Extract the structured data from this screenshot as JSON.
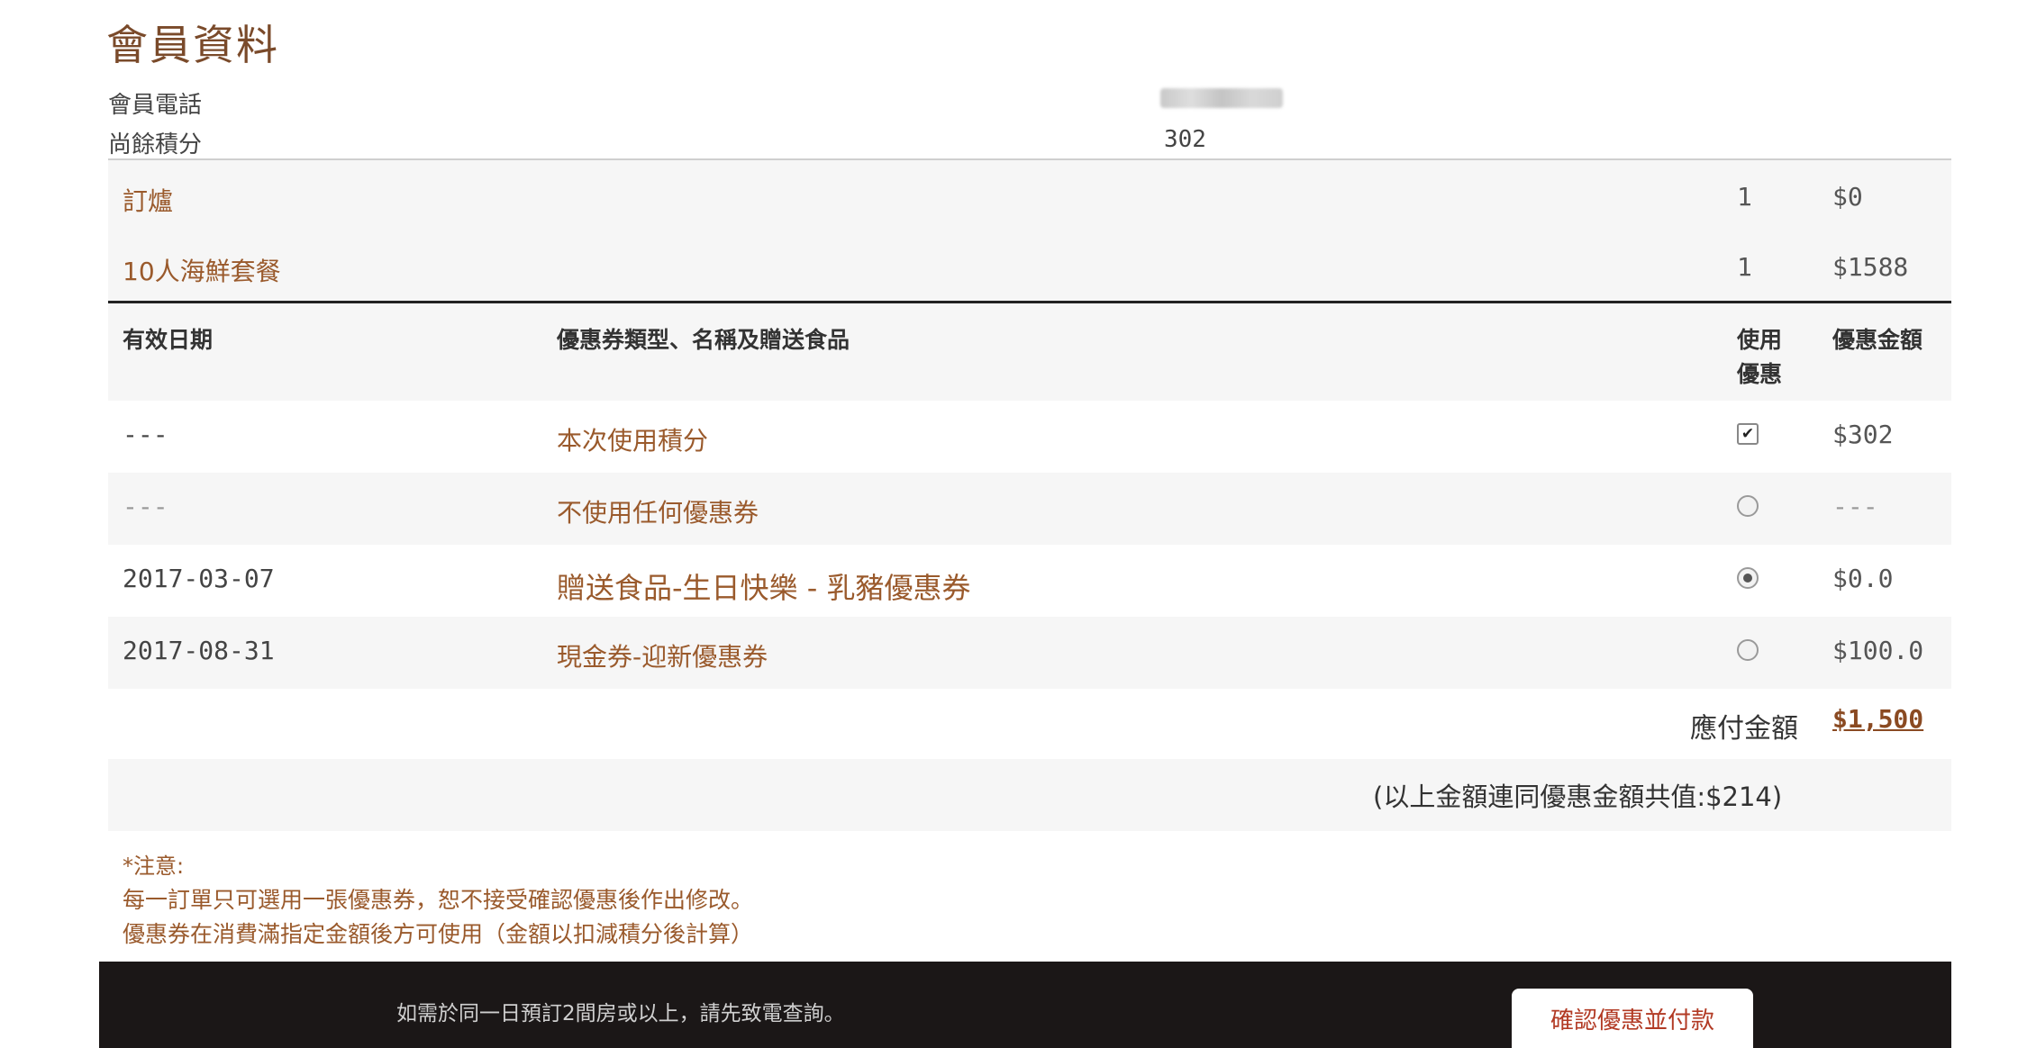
{
  "page_title": "會員資料",
  "member": {
    "phone_label": "會員電話",
    "points_label": "尚餘積分",
    "points_value": "302"
  },
  "order_items": [
    {
      "name": "訂爐",
      "qty": "1",
      "price": "$0"
    },
    {
      "name": "10人海鮮套餐",
      "qty": "1",
      "price": "$1588"
    }
  ],
  "coupon_table": {
    "headers": {
      "date": "有效日期",
      "type": "優惠券類型、名稱及贈送食品",
      "use_line1": "使用",
      "use_line2": "優惠",
      "amount": "優惠金額"
    },
    "rows": [
      {
        "date": "---",
        "name": "本次使用積分",
        "control": "checkbox",
        "checked": true,
        "amount": "$302"
      },
      {
        "date": "---",
        "name": "不使用任何優惠券",
        "control": "radio",
        "checked": false,
        "amount": "---"
      },
      {
        "date": "2017-03-07",
        "name": "贈送食品-生日快樂 - 乳豬優惠券",
        "control": "radio",
        "checked": true,
        "amount": "$0.0"
      },
      {
        "date": "2017-08-31",
        "name": "現金券-迎新優惠券",
        "control": "radio",
        "checked": false,
        "amount": "$100.0"
      }
    ]
  },
  "total": {
    "label": "應付金額",
    "value": "$1,500",
    "note": "(以上金額連同優惠金額共值:$214)"
  },
  "notice": {
    "heading": "*注意:",
    "line1": "每一訂單只可選用一張優惠券，恕不接受確認優惠後作出修改。",
    "line2": "優惠券在消費滿指定金額後方可使用（金額以扣減積分後計算）"
  },
  "footer": {
    "message": "如需於同一日預訂2間房或以上，請先致電查詢。",
    "pay_button": "確認優惠並付款"
  },
  "colors": {
    "accent_brown": "#9a5a2c",
    "title_brown": "#7a4a2a",
    "footer_bg": "#1b1717",
    "button_text": "#b23a24"
  }
}
